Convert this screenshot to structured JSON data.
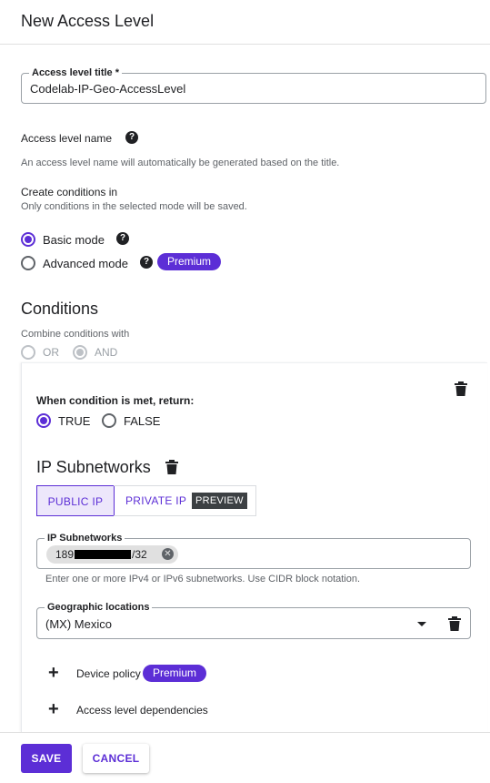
{
  "header": {
    "title": "New Access Level"
  },
  "title_field": {
    "label": "Access level title *",
    "value": "Codelab-IP-Geo-AccessLevel"
  },
  "name": {
    "label": "Access level name",
    "help_icon": "help-circle-icon",
    "description": "An access level name will automatically be generated based on the title."
  },
  "create_conditions": {
    "label": "Create conditions in",
    "hint": "Only conditions in the selected mode will be saved.",
    "basic_mode": "Basic mode",
    "advanced_mode": "Advanced mode",
    "premium": "Premium",
    "selected": "basic"
  },
  "conditions": {
    "title": "Conditions",
    "combine_label": "Combine conditions with",
    "or": "OR",
    "and": "AND",
    "selected": "AND"
  },
  "condition_card": {
    "return_label": "When condition is met, return:",
    "true": "TRUE",
    "false": "FALSE",
    "selected": "TRUE",
    "ip_section": {
      "title": "IP Subnetworks",
      "public_tab": "PUBLIC IP",
      "private_tab": "PRIVATE IP",
      "preview_tag": "PREVIEW",
      "active_tab": "PUBLIC IP",
      "field_label": "IP Subnetworks",
      "chip_prefix": "189",
      "chip_suffix": "/32",
      "helper": "Enter one or more IPv4 or IPv6 subnetworks. Use CIDR block notation."
    },
    "geo": {
      "label": "Geographic locations",
      "value": "(MX) Mexico"
    },
    "device_policy": {
      "label": "Device policy",
      "premium": "Premium"
    },
    "dependencies": {
      "label": "Access level dependencies"
    }
  },
  "footer": {
    "save": "SAVE",
    "cancel": "CANCEL"
  },
  "colors": {
    "accent": "#5c2ed6",
    "text": "#202124",
    "muted": "#5f6368"
  }
}
